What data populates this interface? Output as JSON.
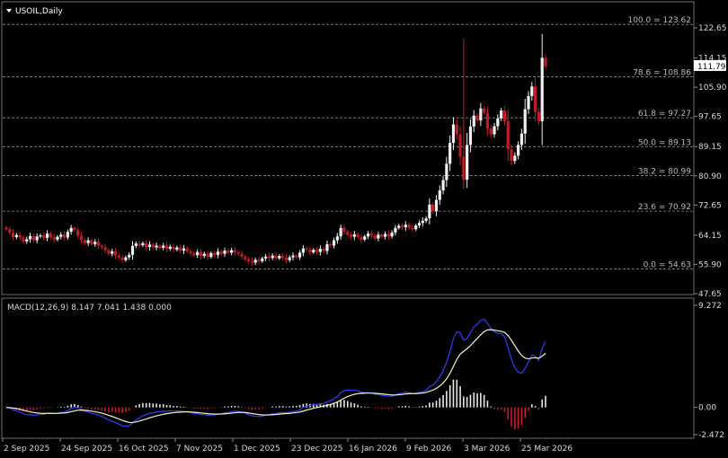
{
  "header": {
    "symbol_label": "USOIL,Daily"
  },
  "chart_data": [
    {
      "type": "candlestick",
      "title": "USOIL,Daily",
      "ylim": [
        46.0,
        126.0
      ],
      "y_ticks": [
        "122.65",
        "114.15",
        "105.90",
        "97.65",
        "89.15",
        "80.90",
        "72.65",
        "64.15",
        "55.90",
        "47.65"
      ],
      "last_price": "111.79",
      "fibonacci": [
        {
          "label": "100.0 = 123.62",
          "value": 123.62
        },
        {
          "label": "78.6 = 108.86",
          "value": 108.86
        },
        {
          "label": "61.8 = 97.27",
          "value": 97.27
        },
        {
          "label": "50.0 = 89.13",
          "value": 89.13
        },
        {
          "label": "38.2 = 80.99",
          "value": 80.99
        },
        {
          "label": "23.6 = 70.92",
          "value": 70.92
        },
        {
          "label": "0.0 = 54.63",
          "value": 54.63
        }
      ],
      "x_labels": [
        "2 Sep 2025",
        "24 Sep 2025",
        "16 Oct 2025",
        "7 Nov 2025",
        "1 Dec 2025",
        "23 Dec 2025",
        "16 Jan 2026",
        "9 Feb 2026",
        "3 Mar 2026",
        "25 Mar 2026"
      ],
      "close": [
        65.8,
        64.9,
        63.6,
        64.2,
        63.5,
        62.4,
        63.0,
        63.9,
        62.7,
        63.8,
        64.1,
        63.4,
        64.6,
        63.6,
        62.9,
        63.7,
        64.3,
        63.5,
        65.1,
        66.2,
        65.6,
        64.0,
        62.8,
        61.9,
        62.7,
        61.6,
        62.3,
        61.2,
        60.8,
        59.9,
        58.9,
        59.6,
        58.4,
        57.8,
        57.1,
        57.9,
        58.6,
        61.1,
        61.8,
        61.3,
        61.9,
        60.8,
        61.5,
        60.7,
        61.2,
        60.6,
        61.2,
        60.3,
        60.9,
        60.1,
        60.7,
        59.8,
        60.4,
        59.6,
        59.1,
        58.5,
        59.4,
        58.3,
        58.9,
        58.0,
        59.1,
        58.6,
        59.5,
        58.9,
        59.8,
        59.2,
        59.9,
        59.3,
        58.9,
        58.1,
        57.3,
        56.8,
        56.4,
        57.2,
        56.8,
        57.6,
        58.1,
        57.7,
        58.4,
        57.6,
        58.3,
        57.8,
        57.1,
        57.9,
        58.4,
        57.9,
        59.2,
        60.4,
        60.1,
        59.3,
        60.0,
        59.4,
        60.3,
        59.7,
        61.6,
        61.2,
        62.7,
        63.8,
        66.2,
        65.1,
        64.3,
        63.7,
        64.4,
        63.6,
        62.9,
        63.8,
        64.6,
        64.1,
        63.2,
        64.3,
        63.7,
        64.5,
        63.8,
        64.9,
        66.2,
        66.8,
        66.4,
        67.1,
        66.2,
        65.8,
        66.9,
        67.6,
        68.2,
        68.9,
        72.8,
        70.9,
        74.1,
        76.8,
        79.7,
        84.3,
        90.2,
        95.4,
        92.6,
        86.3,
        79.8,
        89.6,
        94.8,
        97.9,
        96.5,
        99.9,
        98.7,
        94.2,
        92.6,
        94.9,
        97.1,
        99.3,
        96.3,
        88.4,
        85.1,
        86.6,
        89.6,
        92.8,
        99.7,
        103.4,
        106.1,
        98.9,
        96.3,
        114.2,
        111.79
      ],
      "macd": {
        "label": "MACD(12,26,9) 8.147 7.041 1.438 0.000",
        "ylim": [
          -2.472,
          9.272
        ],
        "y_ticks": [
          "9.272",
          "0.00",
          "-2.472"
        ]
      }
    }
  ]
}
